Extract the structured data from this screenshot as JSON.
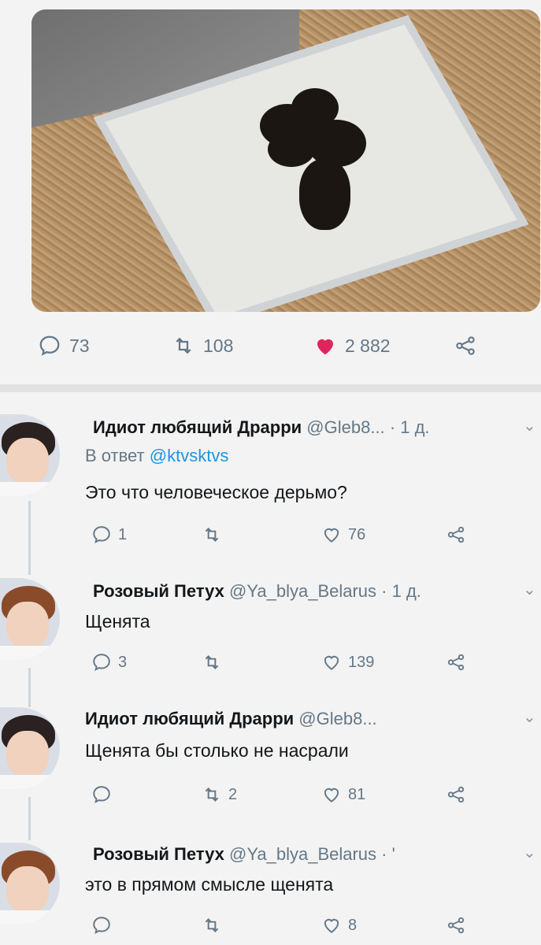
{
  "tweet": {
    "stats": {
      "replies": "73",
      "retweets": "108",
      "likes": "2 882"
    }
  },
  "replies": [
    {
      "name": "Идиот любящий Драрри",
      "handle": "@Gleb8...",
      "time": "· 1 д.",
      "replying_prefix": "В ответ",
      "replying_to": "@ktvsktvs",
      "text": "Это что человеческое дерьмо?",
      "replies": "1",
      "retweets": "",
      "likes": "76"
    },
    {
      "name": "Розовый Петух",
      "handle": "@Ya_blya_Belarus",
      "time": "· 1 д.",
      "text": "Щенята",
      "replies": "3",
      "retweets": "",
      "likes": "139"
    },
    {
      "name": "Идиот любящий Драрри",
      "handle": "@Gleb8...",
      "time": "",
      "text": "Щенята бы столько не насрали",
      "replies": "",
      "retweets": "2",
      "likes": "81"
    },
    {
      "name": "Розовый Петух",
      "handle": "@Ya_blya_Belarus",
      "time": "· '",
      "text": "это в прямом смысле щенята",
      "replies": "",
      "retweets": "",
      "likes": "8"
    }
  ],
  "icons": {
    "reply": "speech-bubble-icon",
    "retweet": "retweet-icon",
    "like": "heart-icon",
    "share": "share-icon",
    "more": "chevron-down-icon"
  },
  "colors": {
    "like_active": "#e0245e",
    "link": "#1b95e0",
    "muted": "#657786"
  }
}
